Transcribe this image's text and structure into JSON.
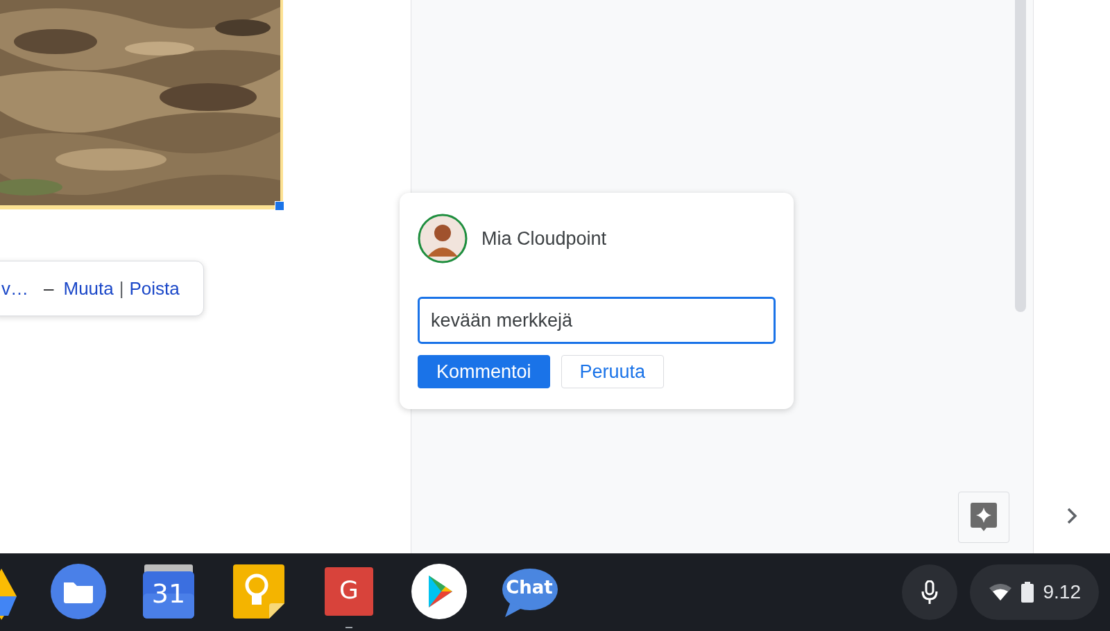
{
  "document": {
    "image": {
      "kind": "picture",
      "selected": true
    },
    "link_popup": {
      "link_text": "v…",
      "dash": "–",
      "actions": [
        "Muuta",
        "Poista"
      ],
      "divider": "|"
    }
  },
  "comment_card": {
    "author": "Mia Cloudpoint",
    "input": {
      "value": "kevään merkkejä"
    },
    "buttons": [
      {
        "label": "Kommentoi",
        "kind": "primary"
      },
      {
        "label": "Peruuta",
        "kind": "secondary"
      }
    ]
  },
  "taskbar": {
    "apps": [
      {
        "kind": "drive"
      },
      {
        "kind": "files",
        "running": false
      },
      {
        "kind": "calendar",
        "label": "31",
        "running": false
      },
      {
        "kind": "keep",
        "running": false
      },
      {
        "kind": "letter",
        "label": "G",
        "running": true
      },
      {
        "kind": "play",
        "running": false
      },
      {
        "kind": "chat",
        "label": "Chat",
        "running": false
      }
    ],
    "time": "9.12"
  }
}
